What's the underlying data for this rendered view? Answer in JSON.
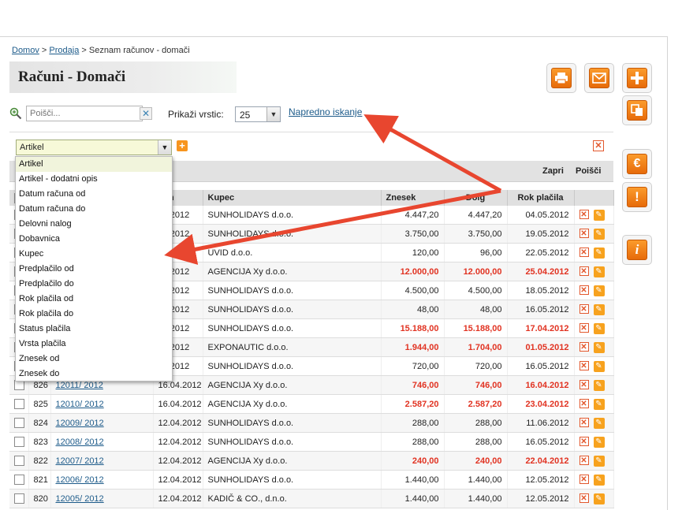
{
  "breadcrumb": {
    "home": "Domov",
    "sep1": " > ",
    "sales": "Prodaja",
    "sep2": " > ",
    "current": "Seznam računov - domači"
  },
  "page_title": "Računi - Domači",
  "search": {
    "placeholder": "Poišči...",
    "value": ""
  },
  "rows_label": "Prikaži vrstic:",
  "rows_value": "25",
  "advanced_search": "Napredno iskanje",
  "filter": {
    "selected": "Artikel",
    "options": [
      "Artikel",
      "Artikel - dodatni opis",
      "Datum računa od",
      "Datum računa do",
      "Delovni nalog",
      "Dobavnica",
      "Kupec",
      "Predplačilo od",
      "Predplačilo do",
      "Rok plačila od",
      "Rok plačila do",
      "Status plačila",
      "Vrsta plačila",
      "Znesek od",
      "Znesek do"
    ]
  },
  "filter_bar": {
    "close": "Zapri",
    "search": "Poišči"
  },
  "table": {
    "columns": {
      "date": "tum",
      "customer": "Kupec",
      "amount": "Znesek",
      "debt": "Dolg",
      "due": "Rok plačila"
    },
    "rows": [
      {
        "num": "",
        "invoice": "",
        "date": "04.2012",
        "customer": "SUNHOLIDAYS d.o.o.",
        "amount": "4.447,20",
        "debt": "4.447,20",
        "due": "04.05.2012",
        "overdue": false
      },
      {
        "num": "",
        "invoice": "",
        "date": "04.2012",
        "customer": "SUNHOLIDAYS d.o.o.",
        "amount": "3.750,00",
        "debt": "3.750,00",
        "due": "19.05.2012",
        "overdue": false
      },
      {
        "num": "",
        "invoice": "",
        "date": "04.2012",
        "customer": "UVID d.o.o.",
        "amount": "120,00",
        "debt": "96,00",
        "due": "22.05.2012",
        "overdue": false
      },
      {
        "num": "",
        "invoice": "",
        "date": "04.2012",
        "customer": "AGENCIJA Xy d.o.o.",
        "amount": "12.000,00",
        "debt": "12.000,00",
        "due": "25.04.2012",
        "overdue": true
      },
      {
        "num": "",
        "invoice": "",
        "date": "04.2012",
        "customer": "SUNHOLIDAYS d.o.o.",
        "amount": "4.500,00",
        "debt": "4.500,00",
        "due": "18.05.2012",
        "overdue": false
      },
      {
        "num": "",
        "invoice": "",
        "date": "04.2012",
        "customer": "SUNHOLIDAYS d.o.o.",
        "amount": "48,00",
        "debt": "48,00",
        "due": "16.05.2012",
        "overdue": false
      },
      {
        "num": "",
        "invoice": "",
        "date": "04.2012",
        "customer": "SUNHOLIDAYS d.o.o.",
        "amount": "15.188,00",
        "debt": "15.188,00",
        "due": "17.04.2012",
        "overdue": true
      },
      {
        "num": "",
        "invoice": "",
        "date": "04.2012",
        "customer": "EXPONAUTIC d.o.o.",
        "amount": "1.944,00",
        "debt": "1.704,00",
        "due": "01.05.2012",
        "overdue": true
      },
      {
        "num": "",
        "invoice": "",
        "date": "04.2012",
        "customer": "SUNHOLIDAYS d.o.o.",
        "amount": "720,00",
        "debt": "720,00",
        "due": "16.05.2012",
        "overdue": false
      },
      {
        "num": "826",
        "invoice": "12011/ 2012",
        "date": "16.04.2012",
        "customer": "AGENCIJA Xy d.o.o.",
        "amount": "746,00",
        "debt": "746,00",
        "due": "16.04.2012",
        "overdue": true
      },
      {
        "num": "825",
        "invoice": "12010/ 2012",
        "date": "16.04.2012",
        "customer": "AGENCIJA Xy d.o.o.",
        "amount": "2.587,20",
        "debt": "2.587,20",
        "due": "23.04.2012",
        "overdue": true
      },
      {
        "num": "824",
        "invoice": "12009/ 2012",
        "date": "12.04.2012",
        "customer": "SUNHOLIDAYS d.o.o.",
        "amount": "288,00",
        "debt": "288,00",
        "due": "11.06.2012",
        "overdue": false
      },
      {
        "num": "823",
        "invoice": "12008/ 2012",
        "date": "12.04.2012",
        "customer": "SUNHOLIDAYS d.o.o.",
        "amount": "288,00",
        "debt": "288,00",
        "due": "16.05.2012",
        "overdue": false
      },
      {
        "num": "822",
        "invoice": "12007/ 2012",
        "date": "12.04.2012",
        "customer": "AGENCIJA Xy d.o.o.",
        "amount": "240,00",
        "debt": "240,00",
        "due": "22.04.2012",
        "overdue": true
      },
      {
        "num": "821",
        "invoice": "12006/ 2012",
        "date": "12.04.2012",
        "customer": "SUNHOLIDAYS d.o.o.",
        "amount": "1.440,00",
        "debt": "1.440,00",
        "due": "12.05.2012",
        "overdue": false
      },
      {
        "num": "820",
        "invoice": "12005/ 2012",
        "date": "12.04.2012",
        "customer": "KADIČ & CO., d.n.o.",
        "amount": "1.440,00",
        "debt": "1.440,00",
        "due": "12.05.2012",
        "overdue": false
      }
    ]
  },
  "colors": {
    "accent_orange": "#f7951e",
    "overdue_red": "#e13322",
    "link": "#1d5b8a",
    "annotation_arrow": "#e8462f"
  },
  "icons": {
    "print": "printer-icon",
    "mail": "mail-icon",
    "add": "plus-icon",
    "copy": "copy-icon",
    "euro": "euro-icon",
    "warning": "exclamation-icon",
    "info": "info-icon"
  }
}
